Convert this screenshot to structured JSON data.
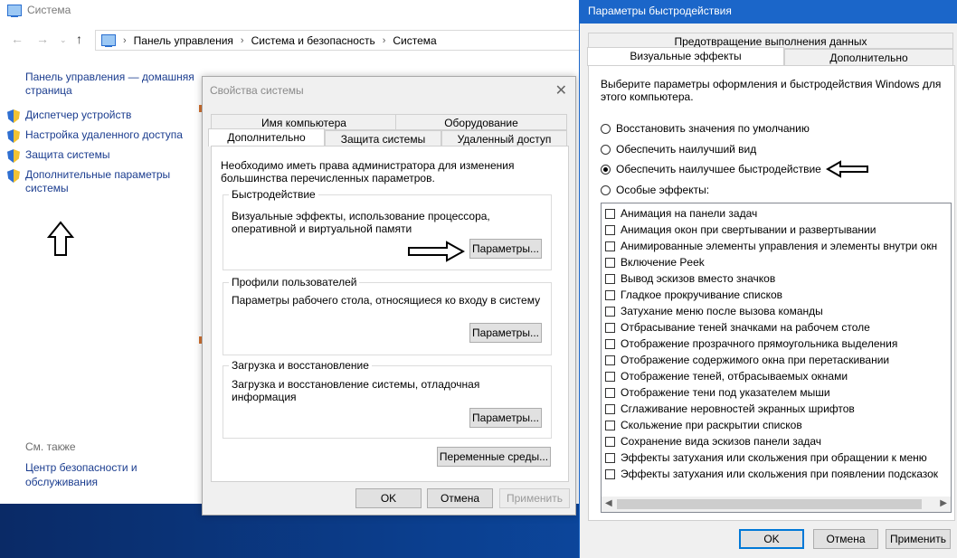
{
  "control_panel": {
    "window_title": "Система",
    "breadcrumbs": [
      "Панель управления",
      "Система и безопасность",
      "Система"
    ],
    "home_link": "Панель управления — домашняя страница",
    "links": [
      "Диспетчер устройств",
      "Настройка удаленного доступа",
      "Защита системы",
      "Дополнительные параметры системы"
    ],
    "see_also_label": "См. также",
    "security_link": "Центр безопасности и обслуживания"
  },
  "system_properties": {
    "title": "Свойства системы",
    "tabs_top": [
      "Имя компьютера",
      "Оборудование"
    ],
    "tabs_bottom": [
      "Дополнительно",
      "Защита системы",
      "Удаленный доступ"
    ],
    "admin_note": "Необходимо иметь права администратора для изменения большинства перечисленных параметров.",
    "performance": {
      "title": "Быстродействие",
      "desc": "Визуальные эффекты, использование процессора, оперативной и виртуальной памяти",
      "button": "Параметры..."
    },
    "profiles": {
      "title": "Профили пользователей",
      "desc": "Параметры рабочего стола, относящиеся ко входу в систему",
      "button": "Параметры..."
    },
    "startup": {
      "title": "Загрузка и восстановление",
      "desc": "Загрузка и восстановление системы, отладочная информация",
      "button": "Параметры..."
    },
    "env_button": "Переменные среды...",
    "ok": "OK",
    "cancel": "Отмена",
    "apply": "Применить"
  },
  "performance_options": {
    "title": "Параметры быстродействия",
    "tab_dep": "Предотвращение выполнения данных",
    "tab_visual": "Визуальные эффекты",
    "tab_advanced": "Дополнительно",
    "intro": "Выберите параметры оформления и быстродействия Windows для этого компьютера.",
    "radios": [
      {
        "label": "Восстановить значения по умолчанию",
        "checked": false
      },
      {
        "label": "Обеспечить наилучший вид",
        "checked": false
      },
      {
        "label": "Обеспечить наилучшее быстродействие",
        "checked": true
      },
      {
        "label": "Особые эффекты:",
        "checked": false
      }
    ],
    "effects": [
      "Анимация на панели задач",
      "Анимация окон при свертывании и развертывании",
      "Анимированные элементы управления и элементы внутри окн",
      "Включение Peek",
      "Вывод эскизов вместо значков",
      "Гладкое прокручивание списков",
      "Затухание меню после вызова команды",
      "Отбрасывание теней значками на рабочем столе",
      "Отображение прозрачного прямоугольника выделения",
      "Отображение содержимого окна при перетаскивании",
      "Отображение теней, отбрасываемых окнами",
      "Отображение тени под указателем мыши",
      "Сглаживание неровностей экранных шрифтов",
      "Скольжение при раскрытии списков",
      "Сохранение вида эскизов панели задач",
      "Эффекты затухания или скольжения при обращении к меню",
      "Эффекты затухания или скольжения при появлении подсказок"
    ],
    "ok": "OK",
    "cancel": "Отмена",
    "apply": "Применить"
  }
}
